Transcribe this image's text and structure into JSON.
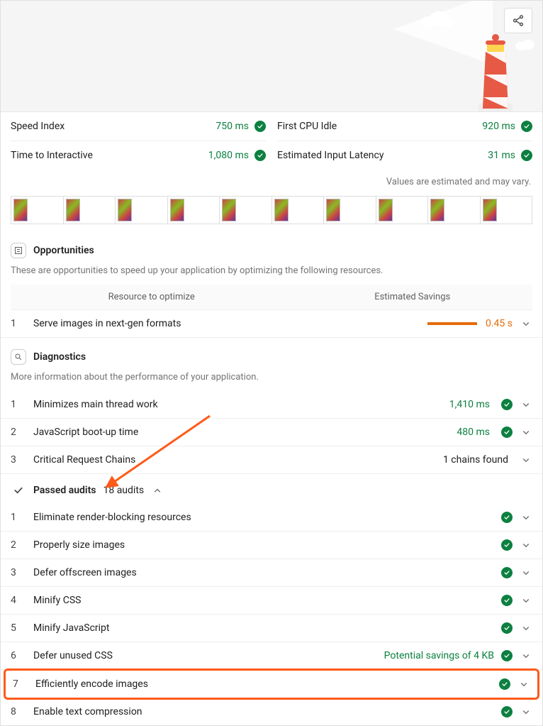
{
  "metrics": {
    "left": [
      {
        "label": "Speed Index",
        "value": "750 ms"
      },
      {
        "label": "Time to Interactive",
        "value": "1,080 ms"
      }
    ],
    "right": [
      {
        "label": "First CPU Idle",
        "value": "920 ms"
      },
      {
        "label": "Estimated Input Latency",
        "value": "31 ms"
      }
    ]
  },
  "disclaimer": "Values are estimated and may vary.",
  "opportunities": {
    "title": "Opportunities",
    "description": "These are opportunities to speed up your application by optimizing the following resources.",
    "headers": {
      "left": "Resource to optimize",
      "right": "Estimated Savings"
    },
    "items": [
      {
        "idx": "1",
        "label": "Serve images in next-gen formats",
        "savings": "0.45 s"
      }
    ]
  },
  "diagnostics": {
    "title": "Diagnostics",
    "description": "More information about the performance of your application.",
    "items": [
      {
        "idx": "1",
        "label": "Minimizes main thread work",
        "value": "1,410 ms",
        "passed": true
      },
      {
        "idx": "2",
        "label": "JavaScript boot-up time",
        "value": "480 ms",
        "passed": true
      },
      {
        "idx": "3",
        "label": "Critical Request Chains",
        "value": "1 chains found",
        "passed": false
      }
    ]
  },
  "passed": {
    "title": "Passed audits",
    "count": "18 audits",
    "items": [
      {
        "idx": "1",
        "label": "Eliminate render-blocking resources",
        "extra": ""
      },
      {
        "idx": "2",
        "label": "Properly size images",
        "extra": ""
      },
      {
        "idx": "3",
        "label": "Defer offscreen images",
        "extra": ""
      },
      {
        "idx": "4",
        "label": "Minify CSS",
        "extra": ""
      },
      {
        "idx": "5",
        "label": "Minify JavaScript",
        "extra": ""
      },
      {
        "idx": "6",
        "label": "Defer unused CSS",
        "extra": "Potential savings of 4 KB"
      },
      {
        "idx": "7",
        "label": "Efficiently encode images",
        "extra": "",
        "highlight": true
      },
      {
        "idx": "8",
        "label": "Enable text compression",
        "extra": ""
      }
    ]
  }
}
